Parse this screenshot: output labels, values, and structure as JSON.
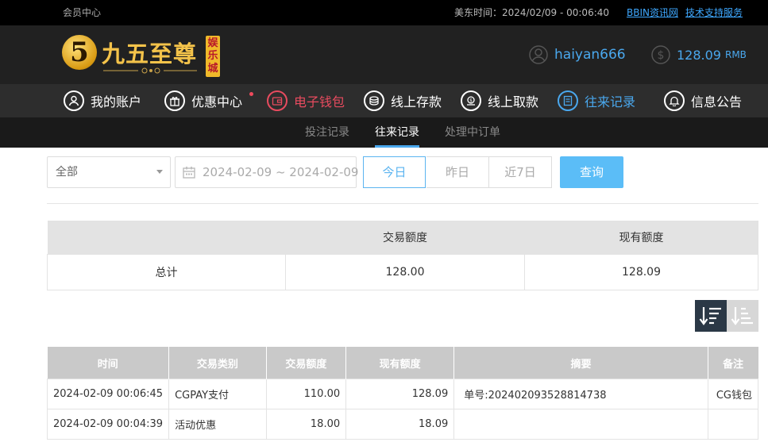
{
  "topbar": {
    "member_center": "会员中心",
    "time_label": "美东时间：2024/02/09 - 00:06:40",
    "bbin_link": "BBIN资讯网",
    "support_link": "技术支持服务"
  },
  "logo": {
    "numeral": "5",
    "title": "九五至尊",
    "stamp": "娱乐城"
  },
  "user": {
    "username": "haiyan666",
    "balance": "128.09",
    "currency": "RMB"
  },
  "nav": {
    "items": [
      {
        "label": "我的账户"
      },
      {
        "label": "优惠中心"
      },
      {
        "label": "电子钱包"
      },
      {
        "label": "线上存款"
      },
      {
        "label": "线上取款"
      },
      {
        "label": "往来记录"
      },
      {
        "label": "信息公告"
      }
    ]
  },
  "subnav": {
    "tabs": [
      {
        "label": "投注记录"
      },
      {
        "label": "往来记录"
      },
      {
        "label": "处理中订单"
      }
    ]
  },
  "filters": {
    "type_selected": "全部",
    "date_range": "2024-02-09 ~ 2024-02-09",
    "presets": [
      "今日",
      "昨日",
      "近7日"
    ],
    "query_label": "查询"
  },
  "summary": {
    "headers": [
      "",
      "交易额度",
      "现有额度"
    ],
    "row": [
      "总计",
      "128.00",
      "128.09"
    ]
  },
  "records": {
    "headers": [
      "时间",
      "交易类别",
      "交易额度",
      "现有额度",
      "摘要",
      "备注"
    ],
    "rows": [
      [
        "2024-02-09 00:06:45",
        "CGPAY支付",
        "110.00",
        "128.09",
        "单号:202402093528814738",
        "CG钱包"
      ],
      [
        "2024-02-09 00:04:39",
        "活动优惠",
        "18.00",
        "18.09",
        "",
        ""
      ]
    ]
  },
  "colors": {
    "accent_blue": "#4aa8ee",
    "accent_red": "#e84b5f",
    "gold": "#f4c34a"
  }
}
